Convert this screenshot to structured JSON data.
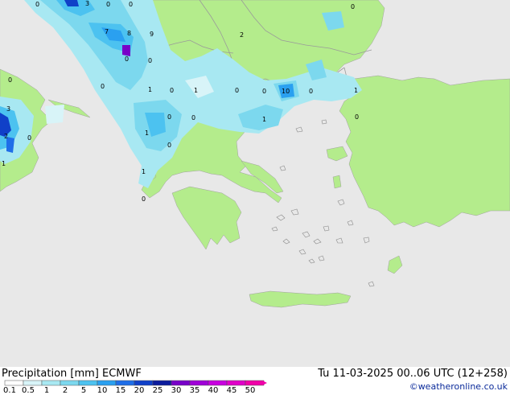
{
  "footer": {
    "title": "Precipitation [mm]  ECMWF",
    "time": "Tu 11-03-2025 00..06 UTC (12+258)",
    "credit": "©weatheronline.co.uk"
  },
  "legend": {
    "ticks": [
      "0.1",
      "0.5",
      "1",
      "2",
      "5",
      "10",
      "15",
      "20",
      "25",
      "30",
      "35",
      "40",
      "45",
      "50"
    ],
    "colors": [
      "#ffffff",
      "#d8f4f8",
      "#a8e8f2",
      "#7cd8ee",
      "#4cc2f0",
      "#2aa0f0",
      "#1f6ee8",
      "#1040c8",
      "#0c1c9c",
      "#7800c8",
      "#a000d8",
      "#c800e0",
      "#e000c8",
      "#f000a8"
    ]
  },
  "colors": {
    "sea": "#e8e8e8",
    "land": "#b4ec8c",
    "border": "#9a9a9a"
  },
  "map_labels": [
    "0",
    "3",
    "0",
    "0",
    "7",
    "8",
    "9",
    "0",
    "2",
    "0",
    "0",
    "0",
    "0",
    "1",
    "0",
    "1",
    "0",
    "0",
    "10",
    "0",
    "1",
    "0",
    "1",
    "3",
    "2",
    "0",
    "1",
    "0",
    "1",
    "0",
    "0",
    "0",
    "1"
  ]
}
